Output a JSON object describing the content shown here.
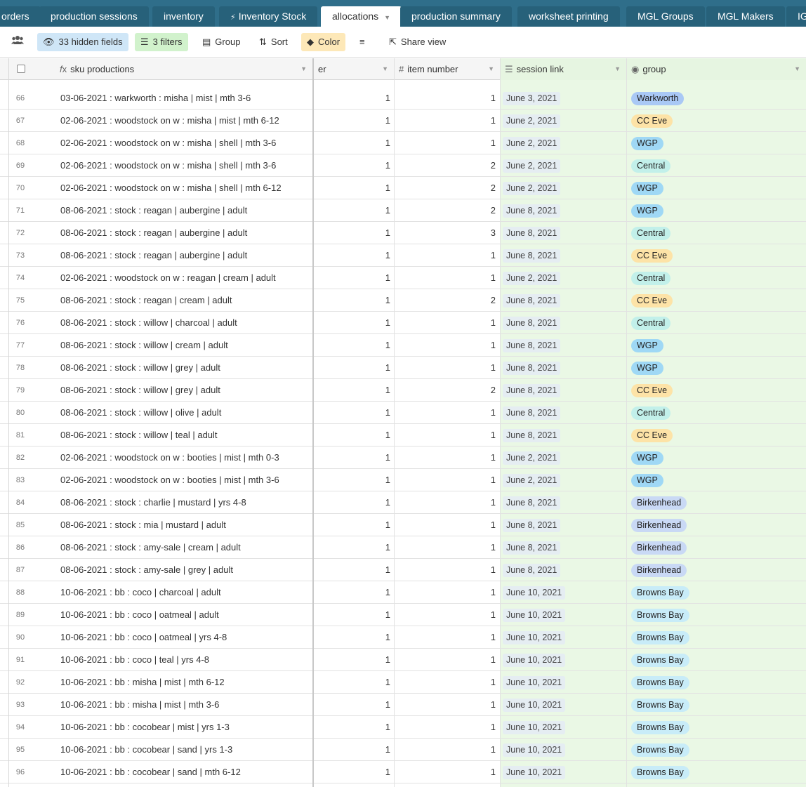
{
  "tabs": [
    {
      "label": "orders",
      "active": false
    },
    {
      "label": "production sessions",
      "active": false
    },
    {
      "label": "inventory",
      "active": false
    },
    {
      "label": "Inventory Stock",
      "active": false,
      "icon": "bolt-icon"
    },
    {
      "label": "allocations",
      "active": true
    },
    {
      "label": "production summary",
      "active": false
    },
    {
      "label": "worksheet printing",
      "active": false
    },
    {
      "label": "MGL Groups",
      "active": false
    },
    {
      "label": "MGL Makers",
      "active": false
    },
    {
      "label": "IG",
      "active": false
    }
  ],
  "toolbar": {
    "hidden_fields": "33 hidden fields",
    "filters": "3 filters",
    "group": "Group",
    "sort": "Sort",
    "color": "Color",
    "share": "Share view"
  },
  "columns": {
    "sku": "sku productions",
    "er": "er",
    "item_number": "item number",
    "session_link": "session link",
    "group": "group"
  },
  "group_colors": {
    "Warkworth": "#a9c8f5",
    "CC Eve": "#fde3a7",
    "WGP": "#9fd8f5",
    "Central": "#c2f0ea",
    "Birkenhead": "#c9d9f5",
    "Browns Bay": "#c8ecf8"
  },
  "rows": [
    {
      "n": "66",
      "sku": "03-06-2021 : warkworth : misha | mist | mth 3-6",
      "er": "1",
      "item": "1",
      "date": "June 3, 2021",
      "group": "Warkworth"
    },
    {
      "n": "67",
      "sku": "02-06-2021 : woodstock on w : misha | mist | mth 6-12",
      "er": "1",
      "item": "1",
      "date": "June 2, 2021",
      "group": "CC Eve"
    },
    {
      "n": "68",
      "sku": "02-06-2021 : woodstock on w : misha | shell | mth 3-6",
      "er": "1",
      "item": "1",
      "date": "June 2, 2021",
      "group": "WGP"
    },
    {
      "n": "69",
      "sku": "02-06-2021 : woodstock on w : misha | shell | mth 3-6",
      "er": "1",
      "item": "2",
      "date": "June 2, 2021",
      "group": "Central"
    },
    {
      "n": "70",
      "sku": "02-06-2021 : woodstock on w : misha | shell | mth 6-12",
      "er": "1",
      "item": "2",
      "date": "June 2, 2021",
      "group": "WGP"
    },
    {
      "n": "71",
      "sku": "08-06-2021 : stock : reagan | aubergine | adult",
      "er": "1",
      "item": "2",
      "date": "June 8, 2021",
      "group": "WGP"
    },
    {
      "n": "72",
      "sku": "08-06-2021 : stock : reagan | aubergine | adult",
      "er": "1",
      "item": "3",
      "date": "June 8, 2021",
      "group": "Central"
    },
    {
      "n": "73",
      "sku": "08-06-2021 : stock : reagan | aubergine | adult",
      "er": "1",
      "item": "1",
      "date": "June 8, 2021",
      "group": "CC Eve"
    },
    {
      "n": "74",
      "sku": "02-06-2021 : woodstock on w : reagan | cream | adult",
      "er": "1",
      "item": "1",
      "date": "June 2, 2021",
      "group": "Central"
    },
    {
      "n": "75",
      "sku": "08-06-2021 : stock : reagan | cream | adult",
      "er": "1",
      "item": "2",
      "date": "June 8, 2021",
      "group": "CC Eve"
    },
    {
      "n": "76",
      "sku": "08-06-2021 : stock : willow | charcoal | adult",
      "er": "1",
      "item": "1",
      "date": "June 8, 2021",
      "group": "Central"
    },
    {
      "n": "77",
      "sku": "08-06-2021 : stock : willow | cream | adult",
      "er": "1",
      "item": "1",
      "date": "June 8, 2021",
      "group": "WGP"
    },
    {
      "n": "78",
      "sku": "08-06-2021 : stock : willow | grey | adult",
      "er": "1",
      "item": "1",
      "date": "June 8, 2021",
      "group": "WGP"
    },
    {
      "n": "79",
      "sku": "08-06-2021 : stock : willow | grey | adult",
      "er": "1",
      "item": "2",
      "date": "June 8, 2021",
      "group": "CC Eve"
    },
    {
      "n": "80",
      "sku": "08-06-2021 : stock : willow | olive | adult",
      "er": "1",
      "item": "1",
      "date": "June 8, 2021",
      "group": "Central"
    },
    {
      "n": "81",
      "sku": "08-06-2021 : stock : willow | teal | adult",
      "er": "1",
      "item": "1",
      "date": "June 8, 2021",
      "group": "CC Eve"
    },
    {
      "n": "82",
      "sku": "02-06-2021 : woodstock on w : booties | mist | mth 0-3",
      "er": "1",
      "item": "1",
      "date": "June 2, 2021",
      "group": "WGP"
    },
    {
      "n": "83",
      "sku": "02-06-2021 : woodstock on w : booties | mist | mth 3-6",
      "er": "1",
      "item": "1",
      "date": "June 2, 2021",
      "group": "WGP"
    },
    {
      "n": "84",
      "sku": "08-06-2021 : stock : charlie | mustard | yrs 4-8",
      "er": "1",
      "item": "1",
      "date": "June 8, 2021",
      "group": "Birkenhead"
    },
    {
      "n": "85",
      "sku": "08-06-2021 : stock : mia | mustard | adult",
      "er": "1",
      "item": "1",
      "date": "June 8, 2021",
      "group": "Birkenhead"
    },
    {
      "n": "86",
      "sku": "08-06-2021 : stock : amy-sale | cream | adult",
      "er": "1",
      "item": "1",
      "date": "June 8, 2021",
      "group": "Birkenhead"
    },
    {
      "n": "87",
      "sku": "08-06-2021 : stock : amy-sale | grey | adult",
      "er": "1",
      "item": "1",
      "date": "June 8, 2021",
      "group": "Birkenhead"
    },
    {
      "n": "88",
      "sku": "10-06-2021 : bb : coco | charcoal | adult",
      "er": "1",
      "item": "1",
      "date": "June 10, 2021",
      "group": "Browns Bay"
    },
    {
      "n": "89",
      "sku": "10-06-2021 : bb : coco | oatmeal | adult",
      "er": "1",
      "item": "1",
      "date": "June 10, 2021",
      "group": "Browns Bay"
    },
    {
      "n": "90",
      "sku": "10-06-2021 : bb : coco | oatmeal | yrs 4-8",
      "er": "1",
      "item": "1",
      "date": "June 10, 2021",
      "group": "Browns Bay"
    },
    {
      "n": "91",
      "sku": "10-06-2021 : bb : coco | teal | yrs 4-8",
      "er": "1",
      "item": "1",
      "date": "June 10, 2021",
      "group": "Browns Bay"
    },
    {
      "n": "92",
      "sku": "10-06-2021 : bb : misha | mist | mth 6-12",
      "er": "1",
      "item": "1",
      "date": "June 10, 2021",
      "group": "Browns Bay"
    },
    {
      "n": "93",
      "sku": "10-06-2021 : bb : misha | mist | mth 3-6",
      "er": "1",
      "item": "1",
      "date": "June 10, 2021",
      "group": "Browns Bay"
    },
    {
      "n": "94",
      "sku": "10-06-2021 : bb : cocobear | mist | yrs 1-3",
      "er": "1",
      "item": "1",
      "date": "June 10, 2021",
      "group": "Browns Bay"
    },
    {
      "n": "95",
      "sku": "10-06-2021 : bb : cocobear | sand | yrs 1-3",
      "er": "1",
      "item": "1",
      "date": "June 10, 2021",
      "group": "Browns Bay"
    },
    {
      "n": "96",
      "sku": "10-06-2021 : bb : cocobear | sand | mth 6-12",
      "er": "1",
      "item": "1",
      "date": "June 10, 2021",
      "group": "Browns Bay"
    }
  ]
}
